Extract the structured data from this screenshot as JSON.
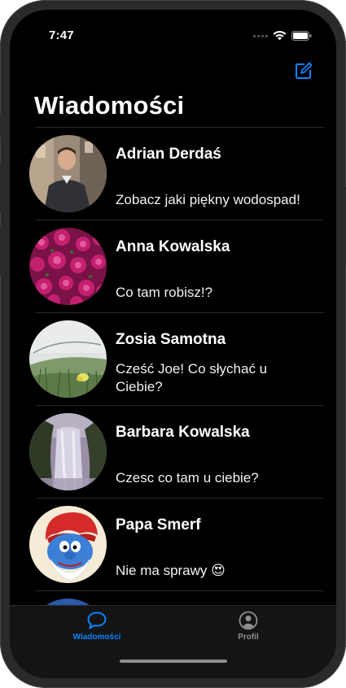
{
  "status_bar": {
    "time": "7:47"
  },
  "header": {
    "title": "Wiadomości",
    "compose_icon": "compose-icon"
  },
  "conversations": [
    {
      "name": "Adrian Derdaś",
      "message": "Zobacz jaki piękny wodospad!",
      "avatar": "avatar-photo-man"
    },
    {
      "name": "Anna Kowalska",
      "message": "Co tam robisz!?",
      "avatar": "avatar-photo-flowers"
    },
    {
      "name": "Zosia Samotna",
      "message": "Cześć Joe! Co słychać u Ciebie?",
      "avatar": "avatar-photo-grass"
    },
    {
      "name": "Barbara Kowalska",
      "message": "Czesc co tam u ciebie?",
      "avatar": "avatar-photo-waterfall"
    },
    {
      "name": "Papa Smerf",
      "message": "Nie ma sprawy 😍",
      "avatar": "avatar-papa-smurf"
    }
  ],
  "tab_bar": {
    "tabs": [
      {
        "label": "Wiadomości",
        "icon": "chat-bubble-icon",
        "active": true
      },
      {
        "label": "Profil",
        "icon": "person-circle-icon",
        "active": false
      }
    ]
  },
  "colors": {
    "accent": "#0a84ff",
    "inactive": "#8e8e93",
    "background": "#000000",
    "tab_bar": "#141414"
  }
}
